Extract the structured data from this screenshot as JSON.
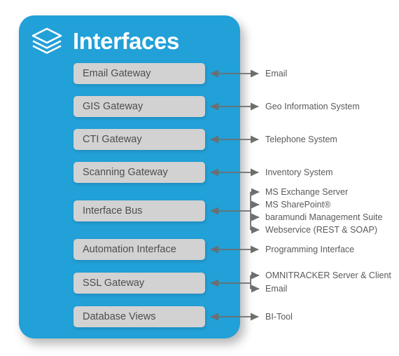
{
  "header": {
    "title": "Interfaces",
    "icon": "layers-icon"
  },
  "colors": {
    "panel_blue": "#22a0d8",
    "box_gray": "#d2d2d2",
    "box_text": "#4d4d4d",
    "label_text": "#5a5a5a",
    "connector_gray": "#6e6e6e",
    "background": "#ffffff"
  },
  "rows": [
    {
      "box": "Email Gateway",
      "targets": [
        "Email"
      ]
    },
    {
      "box": "GIS Gateway",
      "targets": [
        "Geo Information System"
      ]
    },
    {
      "box": "CTI Gateway",
      "targets": [
        "Telephone System"
      ]
    },
    {
      "box": "Scanning Gateway",
      "targets": [
        "Inventory System"
      ]
    },
    {
      "box": "Interface Bus",
      "targets": [
        "MS Exchange Server",
        "MS SharePoint®",
        "baramundi Management Suite",
        "Webservice (REST & SOAP)"
      ]
    },
    {
      "box": "Automation Interface",
      "targets": [
        "Programming Interface"
      ]
    },
    {
      "box": "SSL Gateway",
      "targets": [
        "OMNITRACKER Server & Client",
        "Email"
      ]
    },
    {
      "box": "Database Views",
      "targets": [
        "BI-Tool"
      ]
    }
  ]
}
